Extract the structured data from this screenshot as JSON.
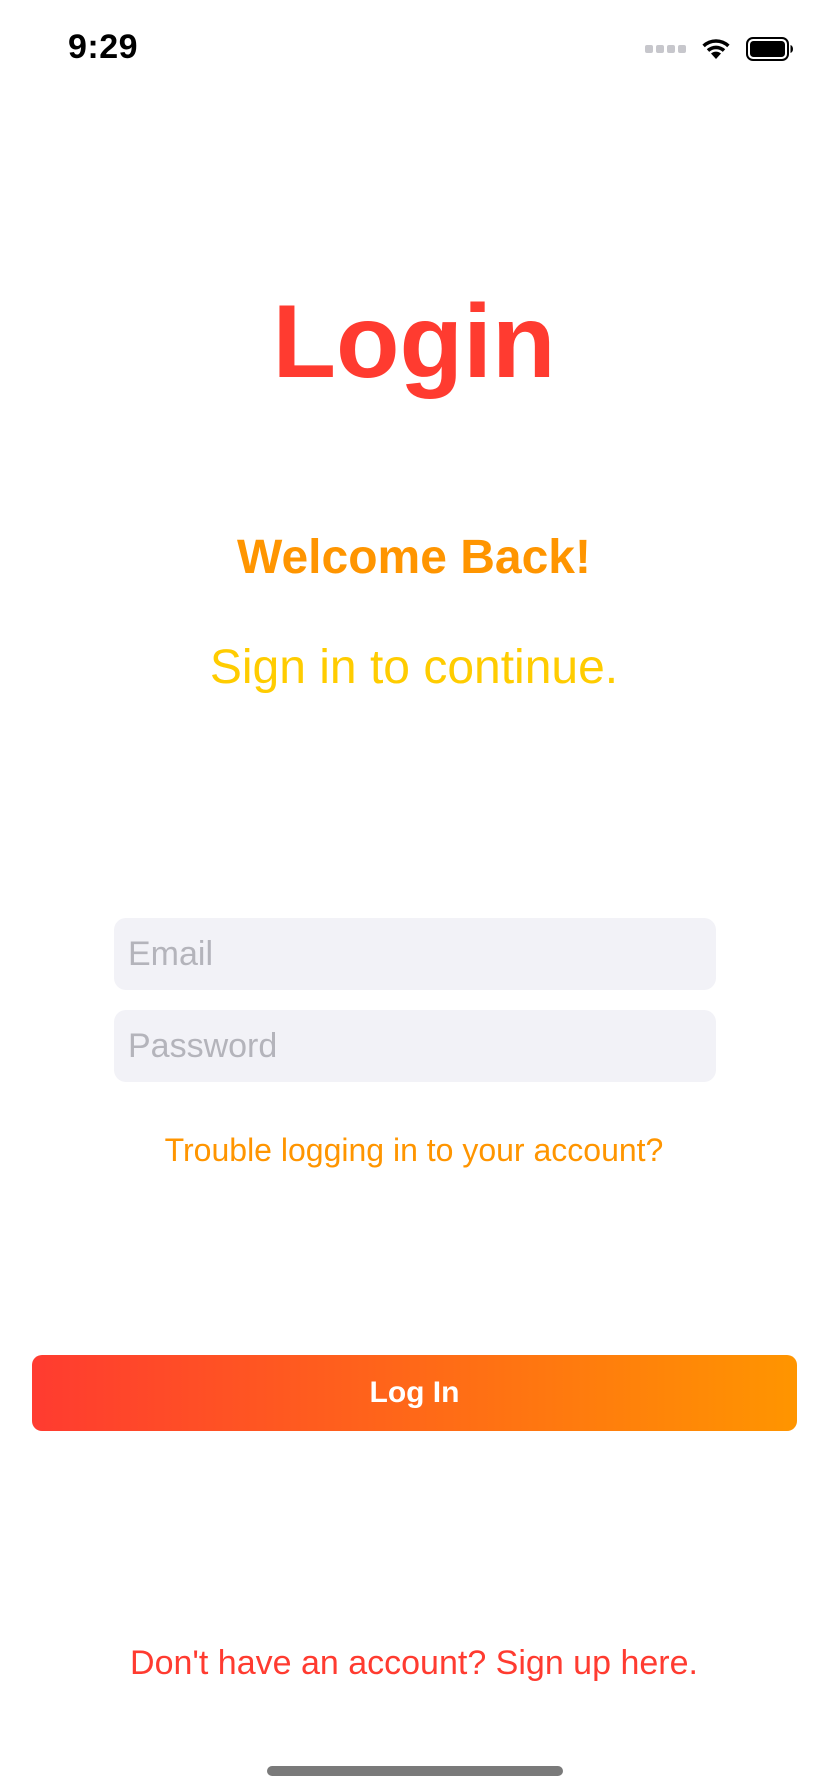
{
  "status_bar": {
    "time": "9:29"
  },
  "header": {
    "title": "Login",
    "welcome": "Welcome Back!",
    "subtitle": "Sign in to continue."
  },
  "form": {
    "email_placeholder": "Email",
    "email_value": "",
    "password_placeholder": "Password",
    "password_value": "",
    "trouble_link": "Trouble logging in to your account?",
    "login_button": "Log In"
  },
  "footer": {
    "signup_link": "Don't have an account? Sign up here."
  },
  "colors": {
    "primary_red": "#ff3b30",
    "accent_orange": "#ff9500",
    "accent_yellow": "#ffcc00",
    "field_background": "#f2f2f7"
  },
  "icons": [
    "cellular-signal-icon",
    "wifi-icon",
    "battery-icon"
  ]
}
